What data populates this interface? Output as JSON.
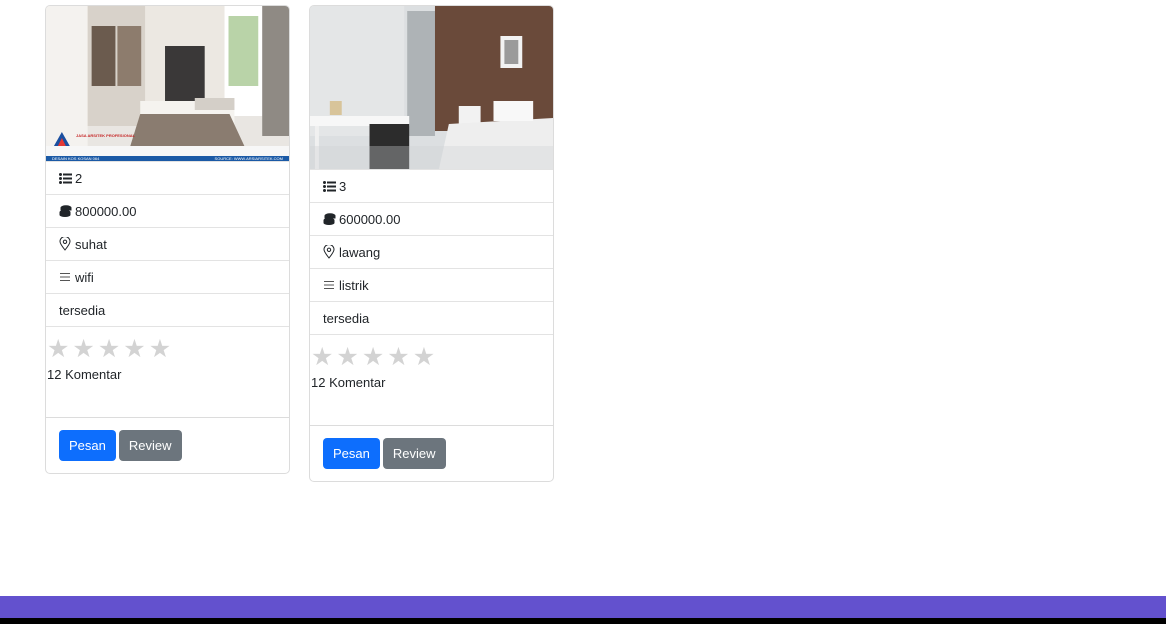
{
  "cards": [
    {
      "rooms": "2",
      "price": "800000.00",
      "location": "suhat",
      "facility": "wifi",
      "status": "tersedia",
      "stars": [
        "★",
        "★",
        "★",
        "★",
        "★"
      ],
      "rating_value": 0,
      "comments": "12 Komentar",
      "image_brand": "JASA ARSITEK PROFESIONAL",
      "image_caption_left": "DESAIN KOS KOSAN 064",
      "image_caption_right": "SOURCE: WWW.ARSIARSITEK.COM",
      "pesan_label": "Pesan",
      "review_label": "Review"
    },
    {
      "rooms": "3",
      "price": "600000.00",
      "location": "lawang",
      "facility": "listrik",
      "status": "tersedia",
      "stars": [
        "★",
        "★",
        "★",
        "★",
        "★"
      ],
      "rating_value": 0,
      "comments": "12 Komentar",
      "pesan_label": "Pesan",
      "review_label": "Review"
    }
  ],
  "colors": {
    "primary": "#0d6efd",
    "secondary": "#6c757d",
    "star_empty": "#d3d3d3",
    "footer": "#6351ce"
  },
  "icons": {
    "rooms": "list-icon",
    "price": "coins-icon",
    "location": "geo-pin-icon",
    "facility": "lines-icon"
  }
}
